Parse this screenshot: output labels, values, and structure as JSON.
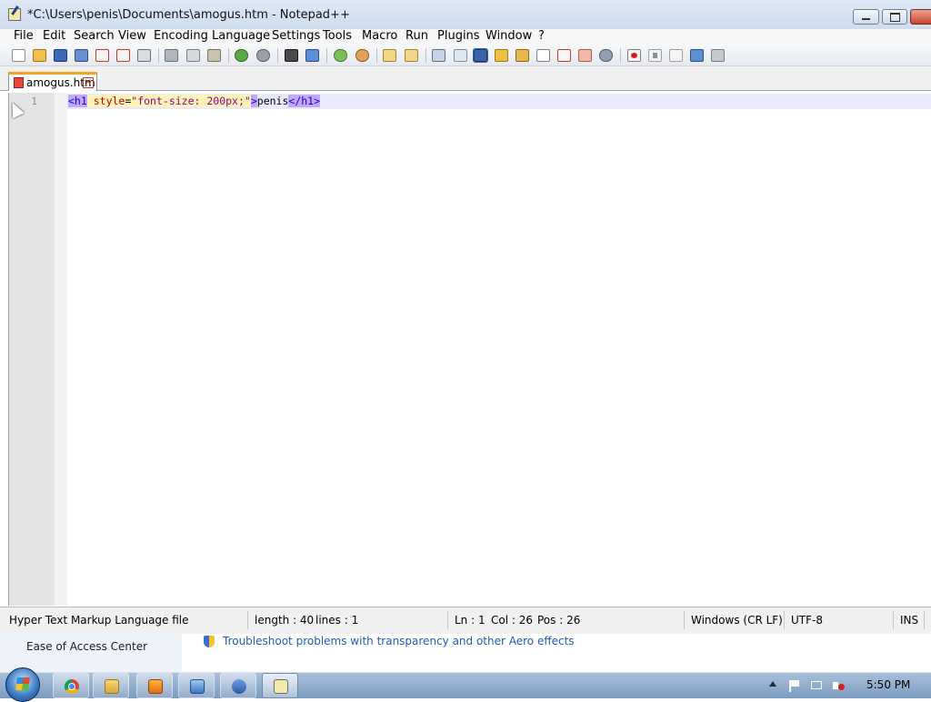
{
  "window": {
    "title": "*C:\\Users\\penis\\Documents\\amogus.htm - Notepad++"
  },
  "menu": [
    "File",
    "Edit",
    "Search",
    "View",
    "Encoding",
    "Language",
    "Settings",
    "Tools",
    "Macro",
    "Run",
    "Plugins",
    "Window",
    "?"
  ],
  "toolbar_icons": [
    "new-file-icon",
    "open-file-icon",
    "save-icon",
    "save-all-icon",
    "close-icon",
    "close-all-icon",
    "print-icon",
    "cut-icon",
    "copy-icon",
    "paste-icon",
    "undo-icon",
    "redo-icon",
    "find-icon",
    "replace-icon",
    "zoom-in-icon",
    "zoom-out-icon",
    "sync-vertical-icon",
    "sync-horizontal-icon",
    "word-wrap-icon",
    "show-all-chars-icon",
    "indent-guide-icon",
    "user-language-icon",
    "doc-map-icon",
    "function-list-icon",
    "folder-workspace-icon",
    "monitoring-icon",
    "record-macro-icon",
    "stop-macro-icon",
    "play-macro-icon",
    "run-macro-multiple-icon",
    "save-macro-icon"
  ],
  "tab": {
    "label": "amogus.htm",
    "close": "×"
  },
  "editor": {
    "line_number": "1",
    "tokens": {
      "open_tag": "<h1",
      "space": " ",
      "attr_name": "style",
      "equals": "=",
      "attr_value": "\"font-size: 200px;\"",
      "gt": ">",
      "text": "penis",
      "close_tag": "</h1>"
    }
  },
  "status": {
    "filetype": "Hyper Text Markup Language file",
    "length": "length : 40",
    "lines": "lines : 1",
    "ln": "Ln : 1",
    "col": "Col : 26",
    "pos": "Pos : 26",
    "eol": "Windows (CR LF)",
    "encoding": "UTF-8",
    "mode": "INS"
  },
  "background_window": {
    "left_link": "Ease of Access Center",
    "link": "Troubleshoot problems with transparency and other Aero effects"
  },
  "taskbar": {
    "clock": "5:50 PM"
  },
  "colors": {
    "tag_background": "#c7a8f2",
    "attribute_background": "#fdf3b8",
    "tab_accent": "#f4a323",
    "current_line": "#e8e8ff"
  }
}
